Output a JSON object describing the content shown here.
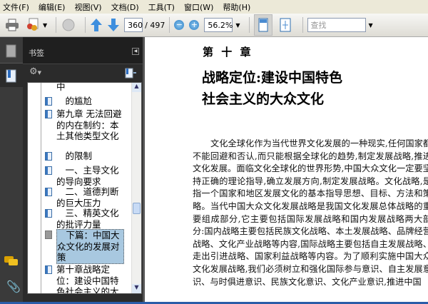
{
  "menu": [
    "文件(F)",
    "编辑(E)",
    "视图(V)",
    "文档(D)",
    "工具(T)",
    "窗口(W)",
    "帮助(H)"
  ],
  "toolbar": {
    "page_current": "360",
    "page_total": "/ 497",
    "zoom": "56.2%",
    "search_placeholder": "查找"
  },
  "panel": {
    "title": "书签",
    "bookmarks": [
      "中",
      "　的尴尬",
      "第九章 无法回避的内在制约：本土其他类型文化",
      "　的限制",
      "　一、主导文化的导向要求",
      "　二、道德判断的巨大压力",
      "　三、精英文化的批评力量",
      "　下篇：中国大众文化的发展对策",
      "第十章战略定位：建设中国特色社会主义的大众"
    ]
  },
  "document": {
    "chapter": "第 十 章",
    "heading1": "战略定位:建设中国特色",
    "heading2": "社会主义的大众文化",
    "body": "文化全球化作为当代世界文化发展的一种现实,任何国家都不能回避和否认,而只能根据全球化的趋势,制定发展战略,推进文化发展。面临文化全球化的世界形势,中国大众文化一定要坚持正确的理论指导,确立发展方向,制定发展战略。文化战略,是指一个国家和地区发展文化的基本指导思想、目标、方法和策略。当代中国大众文化发展战略是我国文化发展总体战略的重要组成部分,它主要包括国际发展战略和国内发展战略两大部分:国内战略主要包括民族文化战略、本土发展战略、品牌经营战略、文化产业战略等内容,国际战略主要包括自主发展战略、走出引进战略、国家利益战略等内容。为了顺利实施中国大众文化发展战略,我们必须树立和强化国际参与意识、自主发展意识、与时俱进意识、民族文化意识、文化产业意识,推进中国"
  }
}
